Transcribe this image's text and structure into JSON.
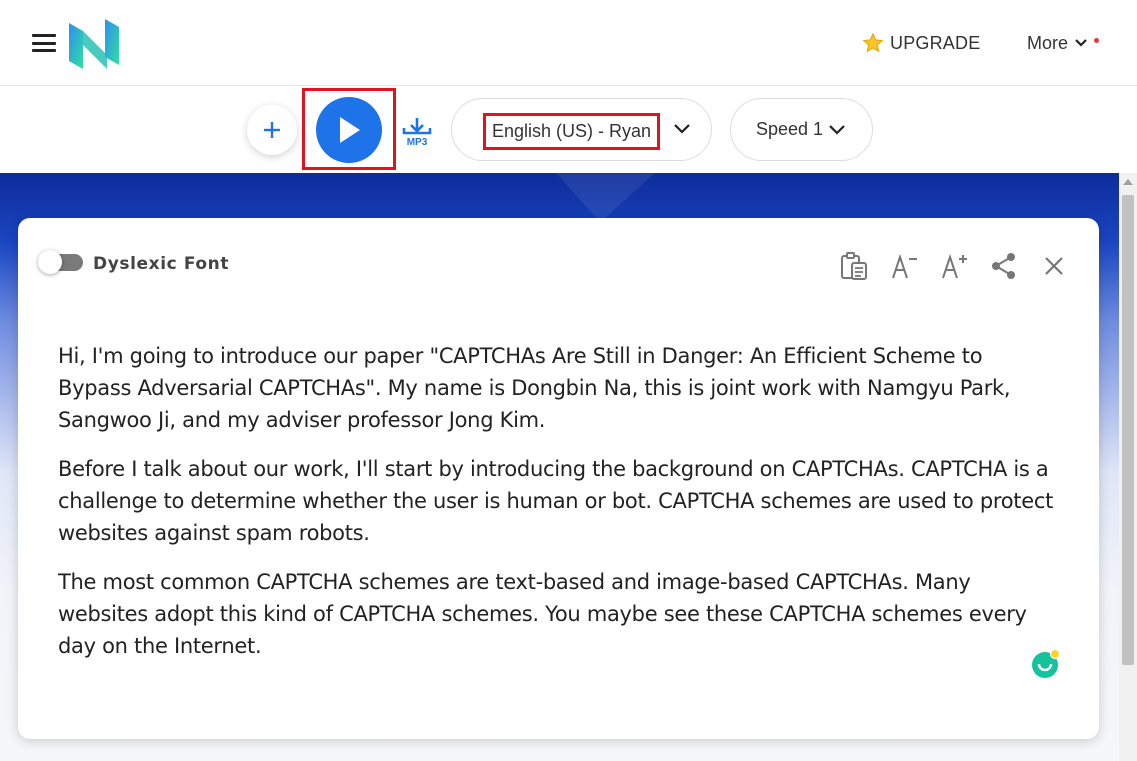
{
  "header": {
    "upgrade_label": "UPGRADE",
    "more_label": "More",
    "brand_colors": {
      "logo_blue": "#2f8ef0",
      "logo_green": "#2fe0a0"
    }
  },
  "toolbar": {
    "voice_label": "English (US) - Ryan",
    "speed_label": "Speed 1",
    "mp3_label": "MP3",
    "accent_color": "#1e73e8",
    "highlight_color": "#e0141e"
  },
  "reader": {
    "dyslexic_font_label": "Dyslexic Font",
    "dyslexic_font_enabled": false,
    "paragraphs": [
      "Hi, I'm going to introduce our paper \"CAPTCHAs Are Still in Danger: An Efficient Scheme to Bypass Adversarial CAPTCHAs\". My name is Dongbin Na, this is joint work with Namgyu Park, Sangwoo Ji, and my adviser professor Jong Kim.",
      "Before I talk about our work, I'll start by introducing the background on CAPTCHAs. CAPTCHA is a challenge to determine whether the user is human or bot. CAPTCHA schemes are used to protect websites against spam robots.",
      "The most common CAPTCHA schemes are text-based and image-based CAPTCHAs. Many websites adopt this kind of CAPTCHA schemes. You maybe see these CAPTCHA schemes every day on the Internet."
    ],
    "tools": [
      "clipboard-icon",
      "decrease-font-icon",
      "increase-font-icon",
      "share-icon",
      "close-icon"
    ]
  }
}
